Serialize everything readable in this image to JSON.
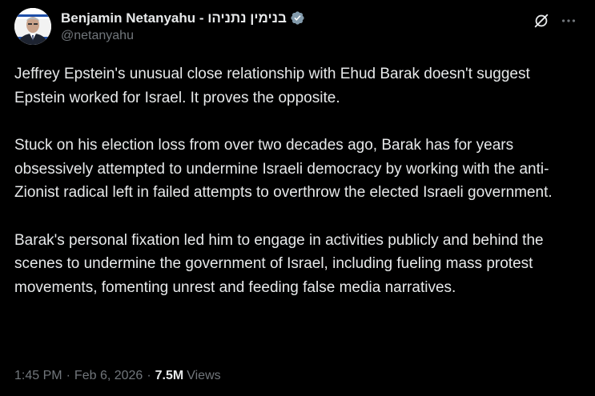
{
  "author": {
    "display_name": "Benjamin Netanyahu - בנימין נתניהו",
    "handle": "@netanyahu",
    "verified": true,
    "avatar_icon": "profile-photo"
  },
  "actions": {
    "grok_icon": "grok-icon",
    "more_icon": "more-horizontal-icon"
  },
  "post": {
    "paragraphs": [
      "Jeffrey Epstein's unusual close relationship with Ehud Barak doesn't suggest Epstein worked for Israel. It proves the opposite.",
      "Stuck on his election loss from over two decades ago, Barak has for years obsessively attempted to undermine Israeli democracy by working with the anti-Zionist radical left in failed attempts to overthrow the elected Israeli government.",
      "Barak's personal fixation led him to engage in activities publicly and behind the scenes to undermine the government of Israel, including fueling mass protest movements, fomenting unrest and feeding false media narratives."
    ]
  },
  "meta": {
    "time": "1:45 PM",
    "separator": "·",
    "date": "Feb 6, 2026",
    "views_count": "7.5M",
    "views_label": "Views"
  },
  "colors": {
    "background": "#000000",
    "text_primary": "#e7e9ea",
    "text_secondary": "#71767b",
    "verified_badge": "#829aab"
  }
}
